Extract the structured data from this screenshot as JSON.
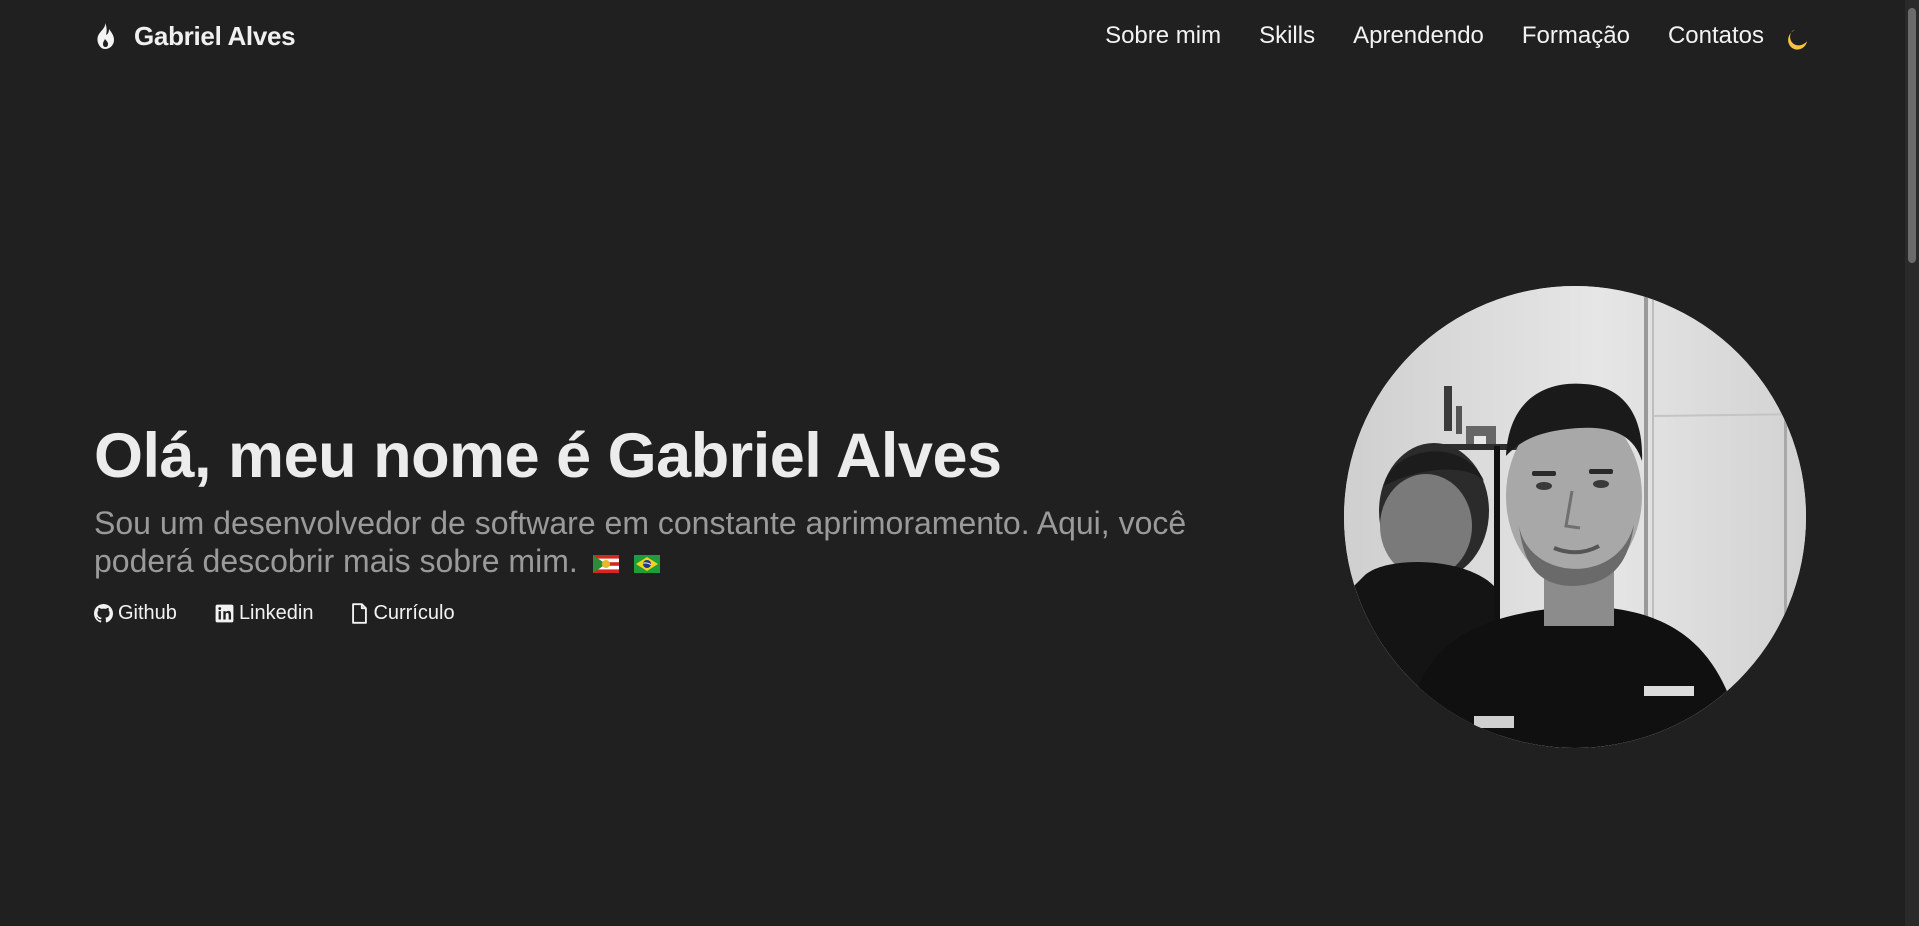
{
  "header": {
    "brand_name": "Gabriel Alves",
    "brand_icon": "flame-icon",
    "nav": [
      {
        "label": "Sobre mim"
      },
      {
        "label": "Skills"
      },
      {
        "label": "Aprendendo"
      },
      {
        "label": "Formação"
      },
      {
        "label": "Contatos"
      }
    ],
    "theme_toggle_icon": "moon-icon"
  },
  "hero": {
    "title": "Olá, meu nome é Gabriel Alves",
    "subtitle": "Sou um desenvolvedor de software em constante aprimoramento. Aqui, você poderá descobrir mais sobre mim.",
    "flags": [
      "santa-catarina-flag-icon",
      "brazil-flag-icon"
    ],
    "links": [
      {
        "label": "Github",
        "icon": "github-icon"
      },
      {
        "label": "Linkedin",
        "icon": "linkedin-icon"
      },
      {
        "label": "Currículo",
        "icon": "file-icon"
      }
    ],
    "avatar_icon": "profile-photo"
  },
  "colors": {
    "background": "#202020",
    "text": "#eaeaea",
    "muted": "#9a9a9a",
    "moon": "#f5c542"
  }
}
